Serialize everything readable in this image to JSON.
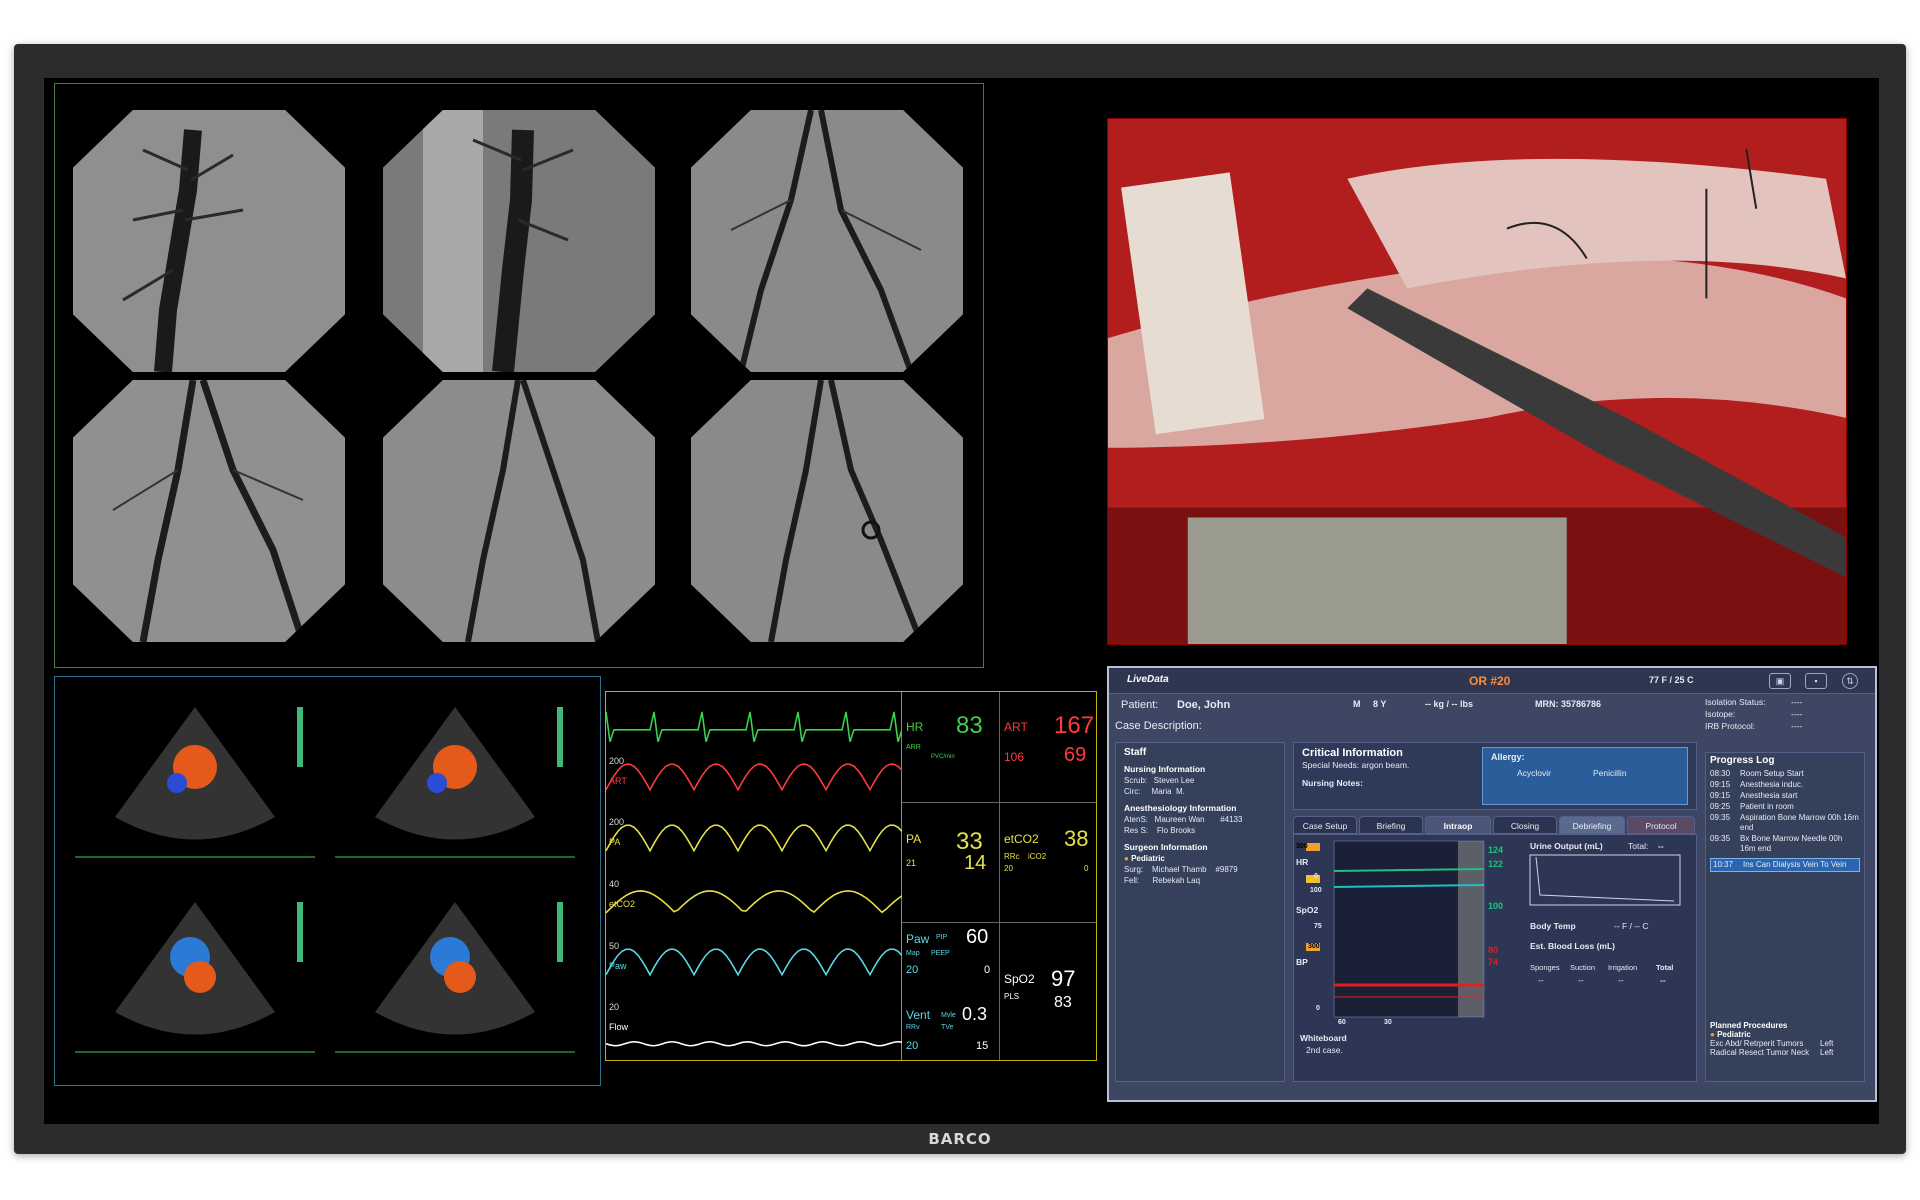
{
  "brand": "BARCO",
  "vitals": {
    "waves": [
      {
        "label": "",
        "color": "#3fd04a",
        "scale": ""
      },
      {
        "label": "ART",
        "color": "#ff3b3b",
        "scale": "200"
      },
      {
        "label": "PA",
        "color": "#e6e04a",
        "scale": "200"
      },
      {
        "label": "etCO2",
        "color": "#e6e04a",
        "scale": "40"
      },
      {
        "label": "Paw",
        "color": "#5ad8e6",
        "scale": "50"
      },
      {
        "label": "Flow",
        "color": "#ffffff",
        "scale": "20"
      }
    ],
    "hr": {
      "label": "HR",
      "value": "83",
      "sub1": "ARR",
      "sub2": "PVC/min",
      "color": "#3fd04a"
    },
    "art": {
      "label": "ART",
      "sys": "167",
      "mean": "106",
      "dia": "69",
      "color": "#ff3b3b"
    },
    "pa": {
      "label": "PA",
      "sys": "33",
      "mean": "21",
      "dia": "14",
      "color": "#e6e04a"
    },
    "etco2": {
      "label": "etCO2",
      "value": "38",
      "sub1": "RRc",
      "sub2": "iCO2",
      "rr": "20",
      "ico2": "0",
      "color": "#e6e04a"
    },
    "paw": {
      "label": "Paw",
      "pip_label": "PIP",
      "pip": "60",
      "map_label": "Map",
      "peep_label": "PEEP",
      "map": "20",
      "peep": "0",
      "color": "#5ad8e6"
    },
    "spo2": {
      "label": "SpO2",
      "value": "97",
      "pls_label": "PLS",
      "pls": "83",
      "color": "#ffffff"
    },
    "vent": {
      "label": "Vent",
      "mv_label": "Mvle",
      "mv": "0.3",
      "rrv_label": "RRv",
      "tv_label": "TVe",
      "rrv": "20",
      "tv": "15",
      "color": "#5ad8e6"
    }
  },
  "livedata": {
    "logo": "LiveData",
    "or": "OR #20",
    "temp": "77 F / 25 C",
    "patient_label": "Patient:",
    "patient_name": "Doe, John",
    "sex": "M",
    "age": "8 Y",
    "weight": "-- kg / -- lbs",
    "mrn": "MRN: 35786786",
    "case_desc": "Case Description:",
    "isolation": [
      "Isolation Status:",
      "Isotope:",
      "IRB Protocol:"
    ],
    "isolation_vals": [
      "----",
      "----",
      "----"
    ],
    "staff": {
      "title": "Staff",
      "nursing": "Nursing Information",
      "nursing_rows": [
        "Scrub:   Steven Lee",
        "Circ:     Maria  M."
      ],
      "anes": "Anesthesiology Information",
      "anes_rows": [
        "AtenS:   Maureen Wan       #4133",
        "Res S:    Flo Brooks"
      ],
      "surgeon": "Surgeon Information",
      "pediatric": "Pediatric",
      "surgeon_rows": [
        "Surg:    Michael Thamb    #9879",
        "Fell:      Rebekah Laq"
      ]
    },
    "critical": {
      "title": "Critical Information",
      "special": "Special Needs: argon beam.",
      "nursing_notes": "Nursing Notes:",
      "allergy_title": "Allergy:",
      "allergies": [
        "Acyclovir",
        "Penicillin"
      ]
    },
    "tabs": [
      "Case Setup",
      "Briefing",
      "Intraop",
      "Closing",
      "Debriefing",
      "Protocol"
    ],
    "intraop": {
      "hr_label": "HR",
      "spo2_label": "SpO2",
      "bp_label": "BP",
      "scale_top": "300",
      "scale_0": "0",
      "scale_100": "100",
      "scale_75": "75",
      "scale_bp": "300",
      "scale_b0": "0",
      "val_hr1": "124",
      "val_hr2": "122",
      "val_spo2": "100",
      "val_bp1": "80",
      "val_bp2": "74",
      "x_ticks": [
        "60",
        "30"
      ],
      "urine": "Urine Output (mL)",
      "total_label": "Total:",
      "total_val": "--",
      "body_temp": "Body Temp",
      "temp_val": "-- F / -- C",
      "ebl": "Est. Blood Loss (mL)",
      "ebl_cols": [
        "Sponges",
        "Suction",
        "Irrigation",
        "Total"
      ],
      "ebl_vals": [
        "--",
        "--",
        "--",
        "--"
      ],
      "whiteboard": "Whiteboard",
      "whiteboard_text": "2nd case."
    },
    "progress": {
      "title": "Progress Log",
      "rows": [
        {
          "t": "08:30",
          "e": "Room Setup Start"
        },
        {
          "t": "09:15",
          "e": "Anesthesia induc."
        },
        {
          "t": "09:15",
          "e": "Anesthesia start"
        },
        {
          "t": "09:25",
          "e": "Patient in room"
        },
        {
          "t": "09:35",
          "e": "Aspiration Bone Marrow 00h 16m end"
        },
        {
          "t": "09:35",
          "e": "Bx Bone Marrow Needle 00h 16m end"
        }
      ],
      "highlight": {
        "t": "10:37",
        "e": "Ins Can Dialysis Vein To Vein"
      },
      "planned_title": "Planned Procedures",
      "planned_pediatric": "Pediatric",
      "planned": [
        {
          "name": "Exc Abd/ Retrperit Tumors",
          "side": "Left"
        },
        {
          "name": "Radical Resect Tumor Neck",
          "side": "Left"
        }
      ]
    }
  }
}
